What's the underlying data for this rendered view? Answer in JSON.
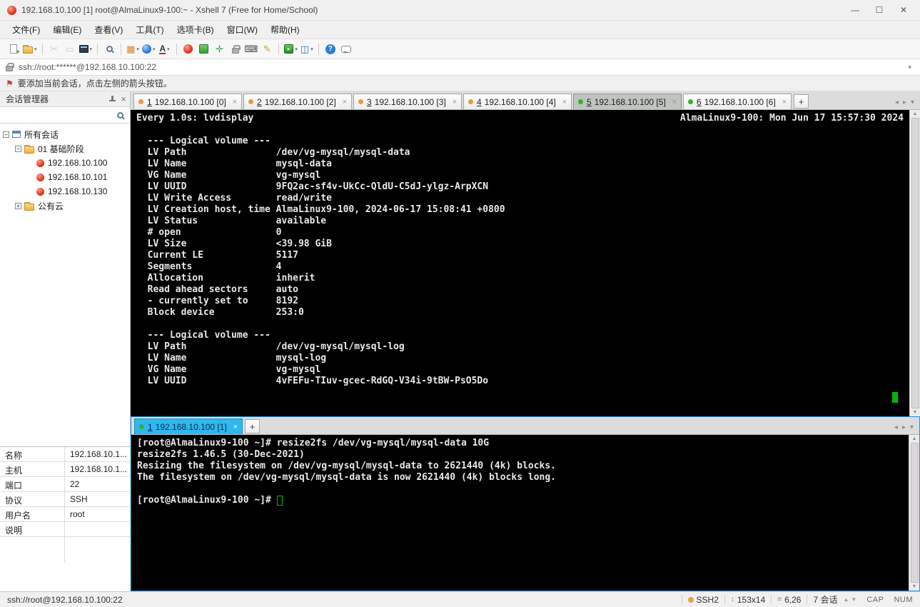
{
  "window": {
    "title": "192.168.10.100 [1] root@AlmaLinux9-100:~ - Xshell 7 (Free for Home/School)",
    "minimize": "—",
    "maximize": "☐",
    "close": "✕"
  },
  "menubar": {
    "items": [
      "文件(F)",
      "编辑(E)",
      "查看(V)",
      "工具(T)",
      "选项卡(B)",
      "窗口(W)",
      "帮助(H)"
    ]
  },
  "toolbar": {
    "items": [
      {
        "name": "new-session-button",
        "shape": "doc-plus"
      },
      {
        "name": "open-session-button",
        "shape": "folder",
        "dropdown": true
      },
      {
        "divider": true
      },
      {
        "name": "cut-button",
        "glyph": "✂",
        "color": "#9a9a9a",
        "disabled": true
      },
      {
        "name": "copy-button",
        "glyph": "▭",
        "color": "#9a9a9a",
        "disabled": true
      },
      {
        "name": "paste-button",
        "shape": "window-dark",
        "dropdown": true
      },
      {
        "divider": true
      },
      {
        "name": "find-button",
        "shape": "magnifier"
      },
      {
        "divider": true
      },
      {
        "name": "tab-arrange-button",
        "glyph": "▦",
        "color": "#cf8430",
        "dropdown": true
      },
      {
        "name": "url-button",
        "shape": "sphere-blue",
        "dropdown": true
      },
      {
        "name": "font-button",
        "shape": "font",
        "dropdown": true
      },
      {
        "divider": true
      },
      {
        "name": "new-xshell-button",
        "shape": "sphere-red"
      },
      {
        "name": "xagent-button",
        "shape": "square-green"
      },
      {
        "name": "fullscreen-button",
        "glyph": "✛",
        "color": "#2fa84f"
      },
      {
        "name": "lock-button",
        "shape": "lock"
      },
      {
        "name": "soft-keyboard-button",
        "glyph": "⌨",
        "color": "#444455"
      },
      {
        "name": "compose-button",
        "glyph": "✎",
        "color": "#c9a227"
      },
      {
        "divider": true
      },
      {
        "name": "file-transfer-button",
        "shape": "square-green2",
        "dropdown": true
      },
      {
        "name": "window-layout-button",
        "glyph": "◫",
        "color": "#2f6fae",
        "dropdown": true
      },
      {
        "divider": true
      },
      {
        "name": "help-button",
        "shape": "circle-help"
      },
      {
        "name": "feedback-button",
        "shape": "bubble"
      }
    ]
  },
  "addressbar": {
    "value": "ssh://root:******@192.168.10.100:22"
  },
  "infobar": {
    "text": "要添加当前会话，点击左侧的箭头按钮。"
  },
  "sidebar": {
    "title": "会话管理器",
    "tree": [
      {
        "level": 0,
        "expander": "-",
        "icon": "window",
        "label": "所有会话"
      },
      {
        "level": 1,
        "expander": "-",
        "icon": "folder",
        "label": "01 基础阶段"
      },
      {
        "level": 2,
        "expander": "",
        "icon": "session",
        "label": "192.168.10.100"
      },
      {
        "level": 2,
        "expander": "",
        "icon": "session",
        "label": "192.168.10.101"
      },
      {
        "level": 2,
        "expander": "",
        "icon": "session",
        "label": "192.168.10.130"
      },
      {
        "level": 1,
        "expander": "+",
        "icon": "folder",
        "label": "公有云"
      }
    ],
    "properties": [
      {
        "label": "名称",
        "value": "192.168.10.1..."
      },
      {
        "label": "主机",
        "value": "192.168.10.1..."
      },
      {
        "label": "端口",
        "value": "22"
      },
      {
        "label": "协议",
        "value": "SSH"
      },
      {
        "label": "用户名",
        "value": "root"
      },
      {
        "label": "说明",
        "value": ""
      }
    ]
  },
  "session_tabs": {
    "add": "+",
    "tabs": [
      {
        "num": "1",
        "label": "192.168.10.100 [0]",
        "dot": "#e89b3c",
        "active": false
      },
      {
        "num": "2",
        "label": "192.168.10.100 [2]",
        "dot": "#e89b3c",
        "active": false
      },
      {
        "num": "3",
        "label": "192.168.10.100 [3]",
        "dot": "#e89b3c",
        "active": false
      },
      {
        "num": "4",
        "label": "192.168.10.100 [4]",
        "dot": "#e89b3c",
        "active": false
      },
      {
        "num": "5",
        "label": "192.168.10.100 [5]",
        "dot": "#2db52d",
        "active": true
      },
      {
        "num": "6",
        "label": "192.168.10.100 [6]",
        "dot": "#2db52d",
        "active": false
      }
    ]
  },
  "bottom_tabs": {
    "add": "+",
    "tabs": [
      {
        "num": "1",
        "label": "192.168.10.100 [1]",
        "dot": "#2db52d",
        "active": true
      }
    ]
  },
  "terminal_top": {
    "header_left": "Every 1.0s: lvdisplay",
    "header_right": "AlmaLinux9-100: Mon Jun 17 15:57:30 2024",
    "lines": [
      "",
      "  --- Logical volume ---",
      "  LV Path                /dev/vg-mysql/mysql-data",
      "  LV Name                mysql-data",
      "  VG Name                vg-mysql",
      "  LV UUID                9FQ2ac-sf4v-UkCc-QldU-C5dJ-ylgz-ArpXCN",
      "  LV Write Access        read/write",
      "  LV Creation host, time AlmaLinux9-100, 2024-06-17 15:08:41 +0800",
      "  LV Status              available",
      "  # open                 0",
      "  LV Size                <39.98 GiB",
      "  Current LE             5117",
      "  Segments               4",
      "  Allocation             inherit",
      "  Read ahead sectors     auto",
      "  - currently set to     8192",
      "  Block device           253:0",
      "",
      "  --- Logical volume ---",
      "  LV Path                /dev/vg-mysql/mysql-log",
      "  LV Name                mysql-log",
      "  VG Name                vg-mysql",
      "  LV UUID                4vFEFu-TIuv-gcec-RdGQ-V34i-9tBW-PsO5Do"
    ]
  },
  "terminal_bottom": {
    "lines": [
      "[root@AlmaLinux9-100 ~]# resize2fs /dev/vg-mysql/mysql-data 10G",
      "resize2fs 1.46.5 (30-Dec-2021)",
      "Resizing the filesystem on /dev/vg-mysql/mysql-data to 2621440 (4k) blocks.",
      "The filesystem on /dev/vg-mysql/mysql-data is now 2621440 (4k) blocks long.",
      "",
      "[root@AlmaLinux9-100 ~]# "
    ]
  },
  "statusbar": {
    "left": "ssh://root@192.168.10.100:22",
    "protocol": "SSH2",
    "terminal_size": "153x14",
    "cursor_pos": "6,26",
    "session_count": "7 会话",
    "cap": "CAP",
    "num": "NUM"
  }
}
